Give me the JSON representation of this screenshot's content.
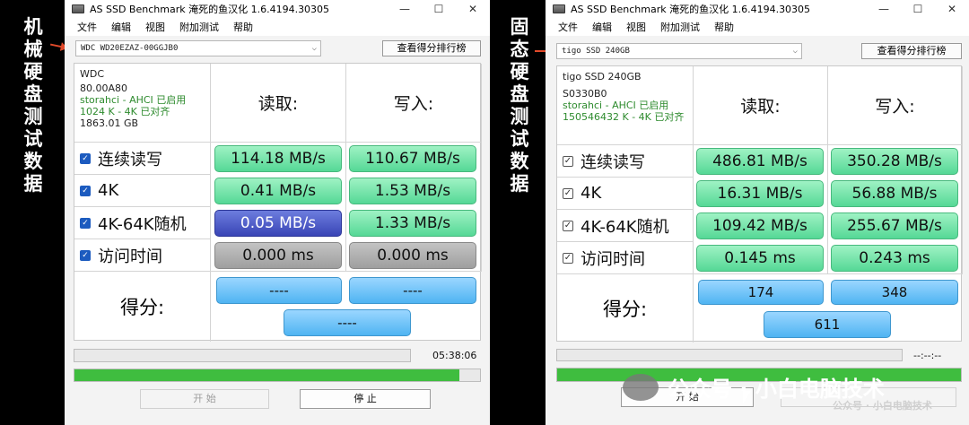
{
  "left_caption": [
    "机",
    "械",
    "硬",
    "盘",
    "测",
    "试",
    "数",
    "据"
  ],
  "right_caption": [
    "固",
    "态",
    "硬",
    "盘",
    "测",
    "试",
    "数",
    "据"
  ],
  "app_title": "AS SSD Benchmark 淹死的鱼汉化 1.6.4194.30305",
  "menu": [
    "文件",
    "编辑",
    "视图",
    "附加测试",
    "帮助"
  ],
  "window_buttons": [
    "—",
    "☐",
    "✕"
  ],
  "rank_button": "查看得分排行榜",
  "headers": {
    "read": "读取:",
    "write": "写入:",
    "score": "得分:"
  },
  "rows": [
    "连续读写",
    "4K",
    "4K-64K随机",
    "访问时间"
  ],
  "check_mark": "✓",
  "hdd": {
    "select": "WDC WD20EZAZ-00GGJB0",
    "info": {
      "model": "WDC",
      "firmware": "80.00A80",
      "driver": "storahci - AHCI 已启用",
      "align": "1024 K - 4K 已对齐",
      "size": "1863.01 GB"
    },
    "read": [
      "114.18 MB/s",
      "0.41 MB/s",
      "0.05 MB/s",
      "0.000 ms"
    ],
    "write": [
      "110.67 MB/s",
      "1.53 MB/s",
      "1.33 MB/s",
      "0.000 ms"
    ],
    "score_read": "----",
    "score_write": "----",
    "score_total": "----",
    "time": "05:38:06",
    "progress": 0.95,
    "start_label": "开  始",
    "stop_label": "停  止"
  },
  "ssd": {
    "select": "tigo SSD 240GB",
    "info": {
      "model": "tigo SSD 240GB",
      "firmware": "S0330B0",
      "driver": "storahci - AHCI 已启用",
      "align": "150546432 K - 4K 已对齐"
    },
    "read": [
      "486.81 MB/s",
      "16.31 MB/s",
      "109.42 MB/s",
      "0.145 ms"
    ],
    "write": [
      "350.28 MB/s",
      "56.88 MB/s",
      "255.67 MB/s",
      "0.243 ms"
    ],
    "score_read": "174",
    "score_write": "348",
    "score_total": "611",
    "time": "--:--:--",
    "progress": 1.0,
    "start_label": "开  始"
  },
  "watermark": {
    "main": "公众号 · 小白电脑技术",
    "small": "公众号 · 小白电脑技术"
  },
  "colors": {
    "bar_green": "#55d896",
    "bar_navy": "#3945b6",
    "bar_gray": "#9f9f9f",
    "bar_sky": "#4fb4f2",
    "progress": "#3fbd3f",
    "arrow": "#e14a2a"
  }
}
